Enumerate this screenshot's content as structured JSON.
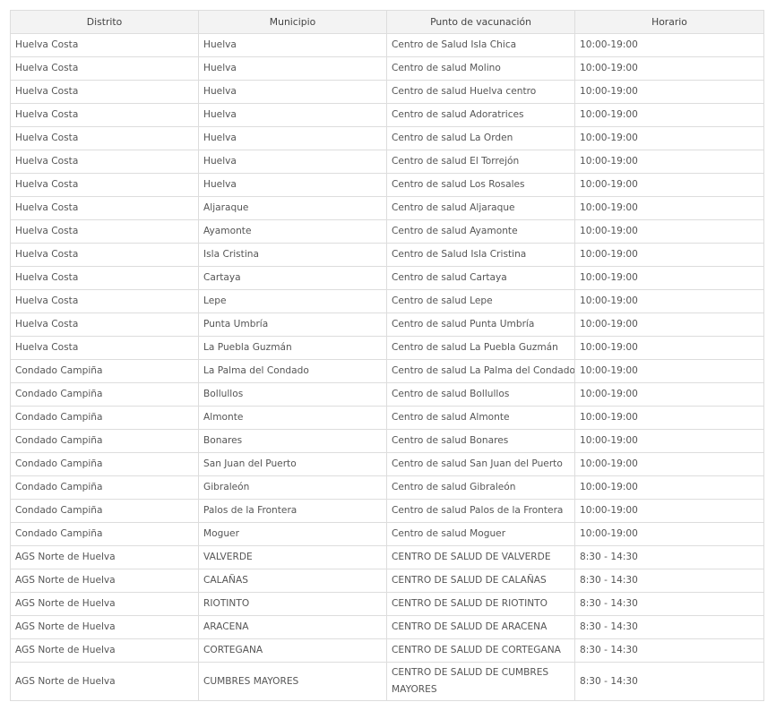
{
  "table": {
    "headers": [
      "Distrito",
      "Municipio",
      "Punto de vacunación",
      "Horario"
    ],
    "rows": [
      [
        "Huelva Costa",
        "Huelva",
        "Centro de Salud Isla Chica",
        "10:00-19:00"
      ],
      [
        "Huelva Costa",
        "Huelva",
        "Centro de salud Molino",
        "10:00-19:00"
      ],
      [
        "Huelva Costa",
        "Huelva",
        "Centro de salud Huelva centro",
        "10:00-19:00"
      ],
      [
        "Huelva Costa",
        "Huelva",
        "Centro de salud Adoratrices",
        "10:00-19:00"
      ],
      [
        "Huelva Costa",
        "Huelva",
        "Centro de salud La Orden",
        "10:00-19:00"
      ],
      [
        "Huelva Costa",
        "Huelva",
        "Centro de salud El Torrejón",
        "10:00-19:00"
      ],
      [
        "Huelva Costa",
        "Huelva",
        "Centro de salud Los Rosales",
        "10:00-19:00"
      ],
      [
        "Huelva Costa",
        "Aljaraque",
        "Centro de salud Aljaraque",
        "10:00-19:00"
      ],
      [
        "Huelva Costa",
        "Ayamonte",
        "Centro de salud Ayamonte",
        "10:00-19:00"
      ],
      [
        "Huelva Costa",
        "Isla Cristina",
        "Centro de Salud Isla Cristina",
        "10:00-19:00"
      ],
      [
        "Huelva Costa",
        "Cartaya",
        "Centro de salud Cartaya",
        "10:00-19:00"
      ],
      [
        "Huelva Costa",
        "Lepe",
        "Centro de salud Lepe",
        "10:00-19:00"
      ],
      [
        "Huelva Costa",
        "Punta Umbría",
        "Centro de salud Punta Umbría",
        "10:00-19:00"
      ],
      [
        "Huelva Costa",
        "La Puebla Guzmán",
        "Centro de salud La Puebla Guzmán",
        "10:00-19:00"
      ],
      [
        "Condado Campiña",
        "La Palma del Condado",
        "Centro de salud La Palma del Condado",
        "10:00-19:00"
      ],
      [
        "Condado Campiña",
        "Bollullos",
        "Centro de salud Bollullos",
        "10:00-19:00"
      ],
      [
        "Condado Campiña",
        "Almonte",
        "Centro de salud Almonte",
        "10:00-19:00"
      ],
      [
        "Condado Campiña",
        "Bonares",
        "Centro de salud Bonares",
        "10:00-19:00"
      ],
      [
        "Condado Campiña",
        "San Juan del Puerto",
        "Centro de salud San Juan del Puerto",
        "10:00-19:00"
      ],
      [
        "Condado Campiña",
        "Gibraleón",
        "Centro de salud Gibraleón",
        "10:00-19:00"
      ],
      [
        "Condado Campiña",
        "Palos de la Frontera",
        "Centro de salud Palos de la Frontera",
        "10:00-19:00"
      ],
      [
        "Condado Campiña",
        "Moguer",
        "Centro de salud Moguer",
        "10:00-19:00"
      ],
      [
        "AGS Norte de Huelva",
        "VALVERDE",
        "CENTRO DE SALUD DE VALVERDE",
        "8:30 - 14:30"
      ],
      [
        "AGS Norte de Huelva",
        "CALAÑAS",
        "CENTRO DE SALUD DE CALAÑAS",
        "8:30 - 14:30"
      ],
      [
        "AGS Norte de Huelva",
        "RIOTINTO",
        "CENTRO DE SALUD DE RIOTINTO",
        "8:30 - 14:30"
      ],
      [
        "AGS Norte de Huelva",
        "ARACENA",
        "CENTRO DE SALUD DE ARACENA",
        "8:30 - 14:30"
      ],
      [
        "AGS Norte de Huelva",
        "CORTEGANA",
        "CENTRO DE SALUD DE CORTEGANA",
        "8:30 - 14:30"
      ],
      [
        "AGS Norte de Huelva",
        "CUMBRES MAYORES",
        "CENTRO DE SALUD DE CUMBRES MAYORES",
        "8:30 - 14:30"
      ]
    ]
  }
}
